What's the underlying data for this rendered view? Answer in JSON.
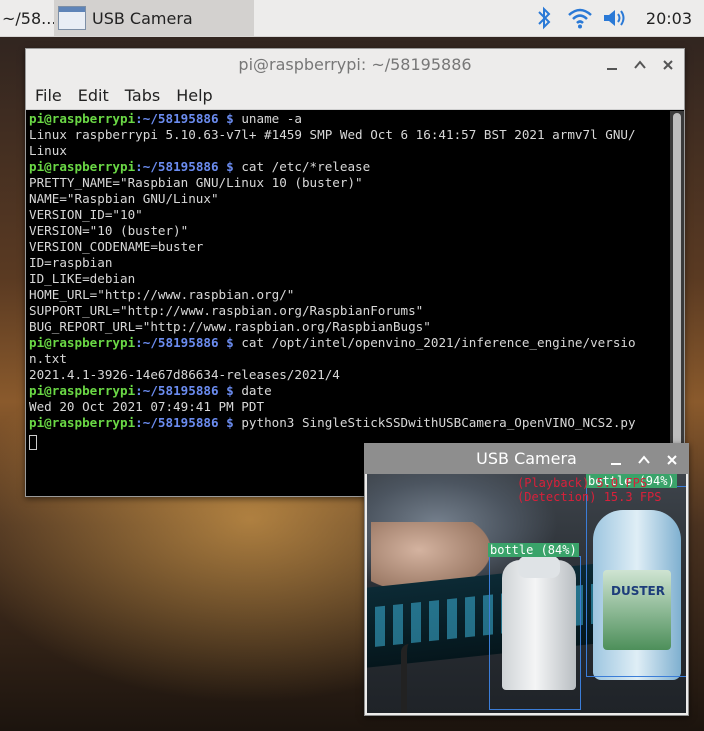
{
  "taskbar": {
    "app1_label": "~/58...",
    "app2_label": "USB Camera",
    "clock": "20:03",
    "icons": [
      "bluetooth-icon",
      "wifi-icon",
      "volume-icon"
    ]
  },
  "terminal": {
    "title": "pi@raspberrypi: ~/58195886",
    "menu": [
      "File",
      "Edit",
      "Tabs",
      "Help"
    ],
    "prompt_user": "pi@raspberrypi",
    "prompt_path": ":~/58195886 $",
    "lines": [
      {
        "type": "cmd",
        "text": " uname -a"
      },
      {
        "type": "out",
        "text": "Linux raspberrypi 5.10.63-v7l+ #1459 SMP Wed Oct 6 16:41:57 BST 2021 armv7l GNU/"
      },
      {
        "type": "out",
        "text": "Linux"
      },
      {
        "type": "cmd",
        "text": " cat /etc/*release"
      },
      {
        "type": "out",
        "text": "PRETTY_NAME=\"Raspbian GNU/Linux 10 (buster)\""
      },
      {
        "type": "out",
        "text": "NAME=\"Raspbian GNU/Linux\""
      },
      {
        "type": "out",
        "text": "VERSION_ID=\"10\""
      },
      {
        "type": "out",
        "text": "VERSION=\"10 (buster)\""
      },
      {
        "type": "out",
        "text": "VERSION_CODENAME=buster"
      },
      {
        "type": "out",
        "text": "ID=raspbian"
      },
      {
        "type": "out",
        "text": "ID_LIKE=debian"
      },
      {
        "type": "out",
        "text": "HOME_URL=\"http://www.raspbian.org/\""
      },
      {
        "type": "out",
        "text": "SUPPORT_URL=\"http://www.raspbian.org/RaspbianForums\""
      },
      {
        "type": "out",
        "text": "BUG_REPORT_URL=\"http://www.raspbian.org/RaspbianBugs\""
      },
      {
        "type": "cmd",
        "text": " cat /opt/intel/openvino_2021/inference_engine/versio"
      },
      {
        "type": "out",
        "text": "n.txt"
      },
      {
        "type": "out",
        "text": "2021.4.1-3926-14e67d86634-releases/2021/4"
      },
      {
        "type": "cmd",
        "text": " date"
      },
      {
        "type": "out",
        "text": "Wed 20 Oct 2021 07:49:41 PM PDT"
      },
      {
        "type": "cmd",
        "text": " python3 SingleStickSSDwithUSBCamera_OpenVINO_NCS2.py"
      }
    ]
  },
  "camera": {
    "title": "USB Camera",
    "overlay_line1": "(Playback) 5.0 FPS",
    "overlay_line2": "(Detection) 15.3 FPS",
    "detections": [
      {
        "label": "bottle (84%)"
      },
      {
        "label": "bottle (94%)"
      }
    ]
  },
  "colors": {
    "prompt_user": "#6ad845",
    "prompt_path": "#6b8cf0",
    "box": "#3b7dd8",
    "label_bg": "#3aa36a",
    "overlay_text": "#d8203a"
  }
}
